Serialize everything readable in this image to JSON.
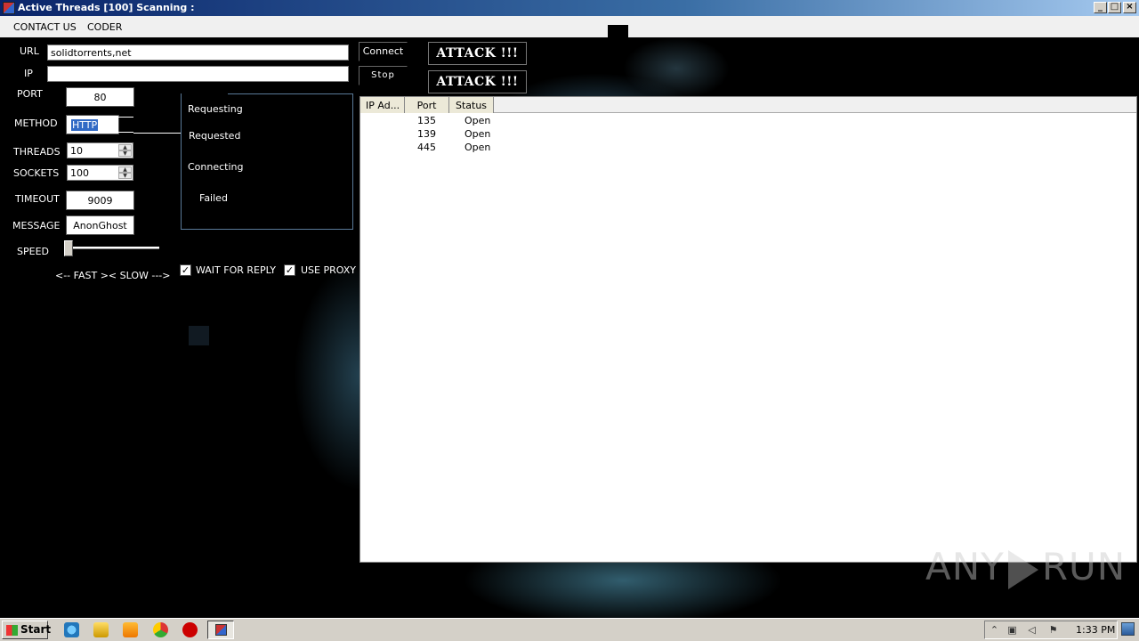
{
  "window": {
    "title": "Active Threads [100] Scanning :"
  },
  "menu": {
    "contact": "CONTACT US",
    "coder": "CODER"
  },
  "form": {
    "url_label": "URL",
    "url_value": "solidtorrents,net",
    "ip_label": "IP",
    "ip_value": "",
    "port_label": "PORT",
    "port_value": "80",
    "method_label": "METHOD",
    "method_value": "HTTP",
    "threads_label": "THREADS",
    "threads_value": "10",
    "sockets_label": "SOCKETS",
    "sockets_value": "100",
    "timeout_label": "TIMEOUT",
    "timeout_value": "9009",
    "message_label": "MESSAGE",
    "message_value": "AnonGhost",
    "speed_label": "SPEED",
    "speed_value": 0,
    "speed_hint": "<--  FAST  ><  SLOW --->"
  },
  "buttons": {
    "connect": "Connect",
    "stop": "Stop",
    "attack1": "ATTACK !!!",
    "attack2": "ATTACK !!!"
  },
  "status": {
    "requesting": "Requesting",
    "requested": "Requested",
    "connecting": "Connecting",
    "failed": "Failed"
  },
  "options": {
    "wait_reply": "WAIT FOR REPLY",
    "wait_reply_checked": true,
    "use_proxy": "USE PROXY",
    "use_proxy_checked": true
  },
  "results": {
    "columns": [
      "IP Ad...",
      "Port",
      "Status"
    ],
    "rows": [
      {
        "ip": "",
        "port": "135",
        "status": "Open"
      },
      {
        "ip": "",
        "port": "139",
        "status": "Open"
      },
      {
        "ip": "",
        "port": "445",
        "status": "Open"
      }
    ]
  },
  "watermark": {
    "left": "ANY",
    "right": "RUN"
  },
  "taskbar": {
    "start": "Start",
    "clock": "1:33 PM",
    "icons": [
      "ie-icon",
      "explorer-icon",
      "media-player-icon",
      "chrome-icon",
      "opera-icon",
      "app-icon"
    ]
  },
  "colors": {
    "title_start": "#0a246a",
    "title_end": "#a6caf0",
    "glow": "#5aaac8"
  }
}
